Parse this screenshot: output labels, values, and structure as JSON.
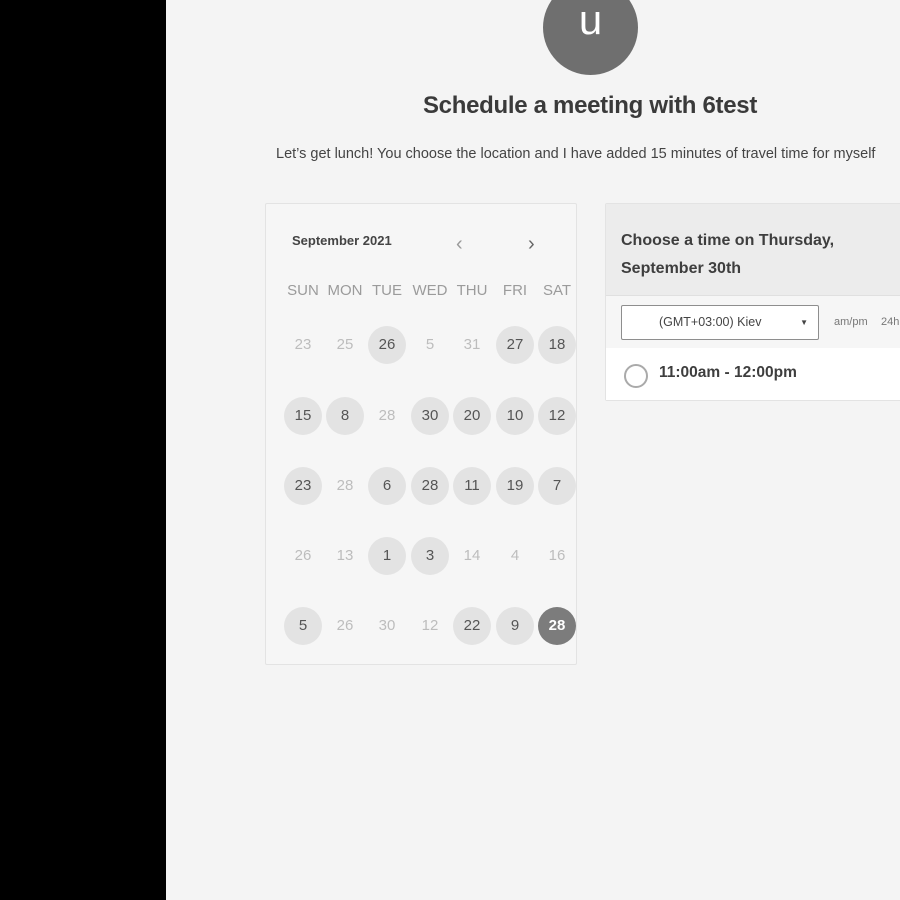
{
  "avatar": {
    "initial": "u"
  },
  "page": {
    "heading": "Schedule a meeting with 6test",
    "subtitle": "Let’s get lunch! You choose the location and I have added 15 minutes of travel time for myself"
  },
  "calendar": {
    "month_label": "September 2021",
    "prev_icon": "‹",
    "next_icon": "›",
    "weekdays": [
      "SUN",
      "MON",
      "TUE",
      "WED",
      "THU",
      "FRI",
      "SAT"
    ],
    "weeks": [
      [
        {
          "d": "23",
          "s": "off"
        },
        {
          "d": "25",
          "s": "off"
        },
        {
          "d": "26",
          "s": "avail"
        },
        {
          "d": "5",
          "s": "off"
        },
        {
          "d": "31",
          "s": "off"
        },
        {
          "d": "27",
          "s": "avail"
        },
        {
          "d": "18",
          "s": "avail"
        }
      ],
      [
        {
          "d": "15",
          "s": "avail"
        },
        {
          "d": "8",
          "s": "avail"
        },
        {
          "d": "28",
          "s": "off"
        },
        {
          "d": "30",
          "s": "avail"
        },
        {
          "d": "20",
          "s": "avail"
        },
        {
          "d": "10",
          "s": "avail"
        },
        {
          "d": "12",
          "s": "avail"
        }
      ],
      [
        {
          "d": "23",
          "s": "avail"
        },
        {
          "d": "28",
          "s": "off"
        },
        {
          "d": "6",
          "s": "avail"
        },
        {
          "d": "28",
          "s": "avail"
        },
        {
          "d": "11",
          "s": "avail"
        },
        {
          "d": "19",
          "s": "avail"
        },
        {
          "d": "7",
          "s": "avail"
        }
      ],
      [
        {
          "d": "26",
          "s": "off"
        },
        {
          "d": "13",
          "s": "off"
        },
        {
          "d": "1",
          "s": "avail"
        },
        {
          "d": "3",
          "s": "avail"
        },
        {
          "d": "14",
          "s": "off"
        },
        {
          "d": "4",
          "s": "off"
        },
        {
          "d": "16",
          "s": "off"
        }
      ],
      [
        {
          "d": "5",
          "s": "avail"
        },
        {
          "d": "26",
          "s": "off"
        },
        {
          "d": "30",
          "s": "off"
        },
        {
          "d": "12",
          "s": "off"
        },
        {
          "d": "22",
          "s": "avail"
        },
        {
          "d": "9",
          "s": "avail"
        },
        {
          "d": "28",
          "s": "selected"
        }
      ]
    ]
  },
  "times_panel": {
    "title_line1": "Choose a time on Thursday,",
    "title_line2": "September 30th",
    "timezone": "(GMT+03:00) Kiev",
    "caret": "▼",
    "format_ampm": "am/pm",
    "format_24h": "24h",
    "slots": [
      {
        "label": "11:00am - 12:00pm"
      }
    ]
  }
}
